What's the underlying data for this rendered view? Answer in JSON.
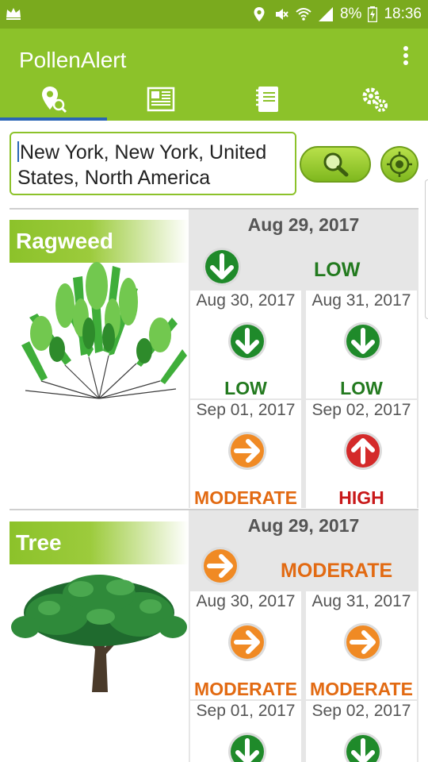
{
  "status_bar": {
    "battery": "8%",
    "time": "18:36",
    "icons": [
      "crown-icon",
      "location-icon",
      "mute-icon",
      "wifi-icon",
      "signal-icon",
      "battery-charging-icon"
    ]
  },
  "app": {
    "title": "PollenAlert",
    "tabs": [
      {
        "name": "location-search",
        "icon": "location-search-icon",
        "active": true
      },
      {
        "name": "news",
        "icon": "newspaper-icon",
        "active": false
      },
      {
        "name": "notes",
        "icon": "notebook-icon",
        "active": false
      },
      {
        "name": "settings",
        "icon": "gears-icon",
        "active": false
      }
    ]
  },
  "search": {
    "value": "New York, New York, United States, North America"
  },
  "colors": {
    "primary": "#8cc22a",
    "status_bar": "#7aaa1e",
    "tab_indicator": "#2a66b5",
    "low": "#237a1f",
    "moderate": "#e26a12",
    "high": "#c8191a"
  },
  "cards": [
    {
      "plant": "Ragweed",
      "today": {
        "date": "Aug 29, 2017",
        "level": "LOW",
        "trend": "down"
      },
      "forecast": [
        {
          "date": "Aug 30, 2017",
          "level": "LOW",
          "trend": "down"
        },
        {
          "date": "Aug 31, 2017",
          "level": "LOW",
          "trend": "down"
        },
        {
          "date": "Sep 01, 2017",
          "level": "MODERATE",
          "trend": "right"
        },
        {
          "date": "Sep 02, 2017",
          "level": "HIGH",
          "trend": "up"
        }
      ]
    },
    {
      "plant": "Tree",
      "today": {
        "date": "Aug 29, 2017",
        "level": "MODERATE",
        "trend": "right"
      },
      "forecast": [
        {
          "date": "Aug 30, 2017",
          "level": "MODERATE",
          "trend": "right"
        },
        {
          "date": "Aug 31, 2017",
          "level": "MODERATE",
          "trend": "right"
        },
        {
          "date": "Sep 01, 2017",
          "level": "",
          "trend": "down"
        },
        {
          "date": "Sep 02, 2017",
          "level": "",
          "trend": "down"
        }
      ]
    }
  ]
}
